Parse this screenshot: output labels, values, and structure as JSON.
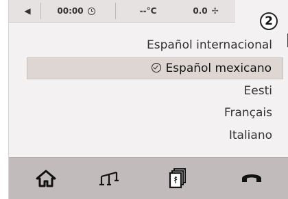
{
  "status_bar": {
    "back_icon": "left-arrow-icon",
    "time": "00:00",
    "time_icon": "clock-icon",
    "temperature": "--°C",
    "fan": "0.0",
    "fan_icon": "fan-icon"
  },
  "badge": {
    "number": "2"
  },
  "language_list": {
    "items": [
      {
        "label": "Español internacional"
      },
      {
        "label": "Español mexicano",
        "selected": true
      },
      {
        "label": "Eesti"
      },
      {
        "label": "Français"
      },
      {
        "label": "Italiano"
      }
    ]
  },
  "bottom_bar": {
    "icons": [
      "home-icon",
      "balance-icon",
      "media-icon",
      "phone-icon"
    ]
  },
  "colors": {
    "screen_bg": "#f3f1f1",
    "selected_row": "#ddd6d2",
    "bottom_bar": "#c2bbbb"
  }
}
